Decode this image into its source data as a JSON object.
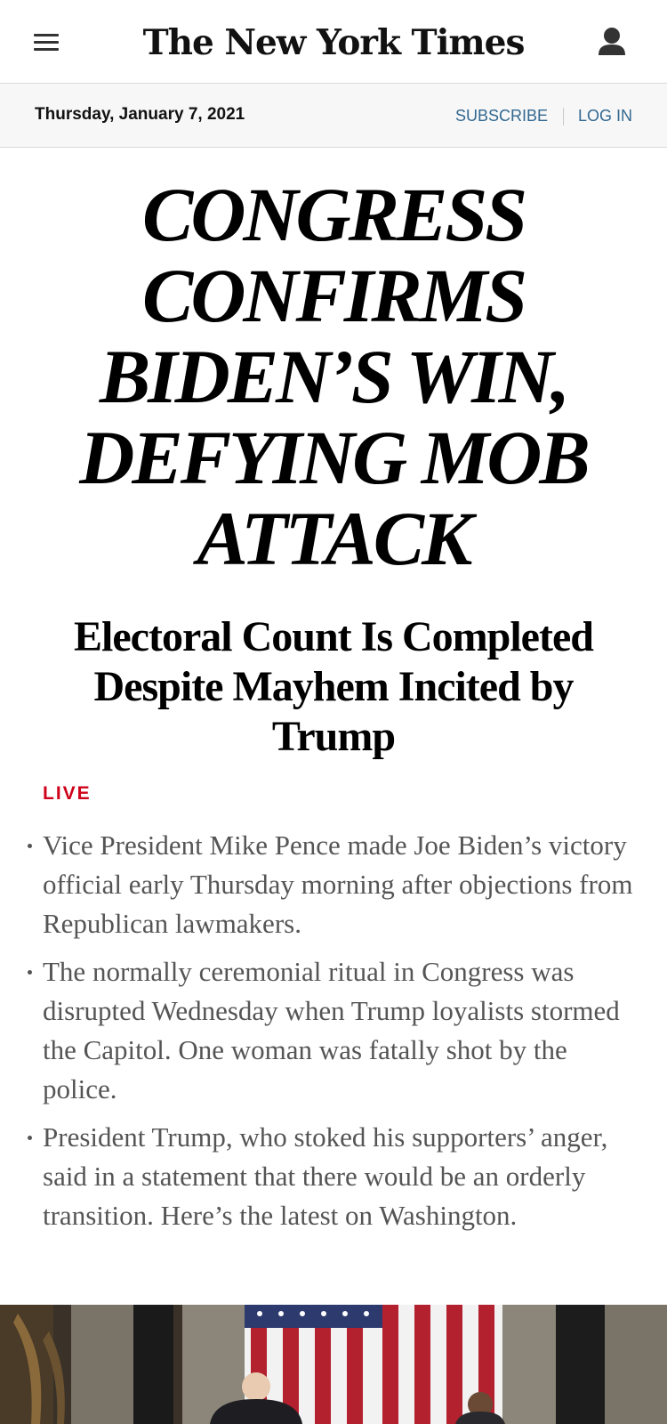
{
  "header": {
    "logo_text": "The New York Times",
    "menu_icon": "hamburger-menu-icon",
    "account_icon": "user-account-icon"
  },
  "datebar": {
    "date": "Thursday, January 7, 2021",
    "subscribe_label": "SUBSCRIBE",
    "login_label": "LOG IN",
    "link_color": "#326891"
  },
  "article": {
    "headline": "CONGRESS CONFIRMS BIDEN’S WIN, DEFYING MOB ATTACK",
    "subhead": "Electoral Count Is Completed Despite Mayhem Incited by Trump",
    "live_label": "LIVE",
    "live_color": "#d0021b",
    "bullets": [
      "Vice President Mike Pence made Joe Biden’s victory official early Thursday morning after objections from Republican lawmakers.",
      "The normally ceremonial ritual in Congress was disrupted Wednesday when Trump loyalists stormed the Capitol. One woman was fatally shot by the police.",
      "President Trump, who stoked his supporters’ anger, said in a statement that there would be an orderly transition. Here’s the latest on Washington."
    ]
  }
}
